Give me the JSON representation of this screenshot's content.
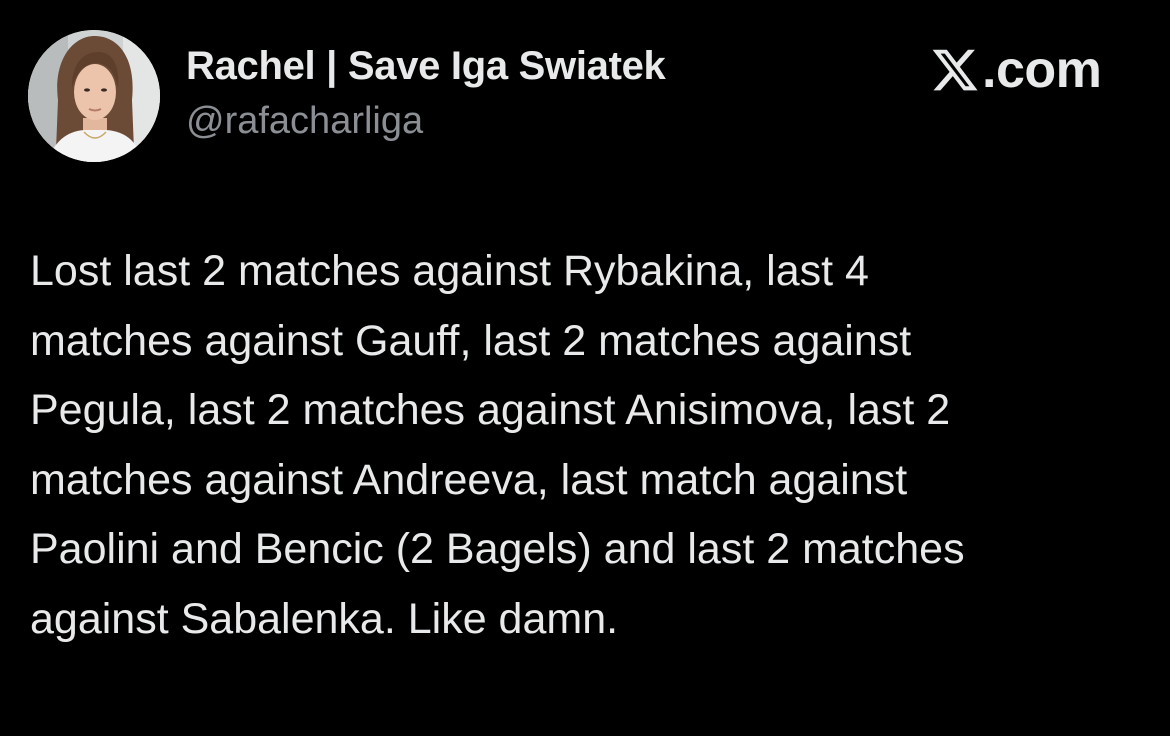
{
  "author": {
    "display_name": "Rachel | Save Iga Swiatek",
    "handle": "@rafacharliga",
    "avatar_icon": "profile-photo"
  },
  "brand": {
    "icon": "x-logo-icon",
    "text": ".com"
  },
  "tweet": {
    "lines": [
      "Lost last 2 matches against Rybakina, last 4",
      "matches against Gauff, last 2 matches against",
      "Pegula, last 2 matches against Anisimova, last 2",
      "matches against Andreeva, last match against",
      "Paolini and Bencic (2 Bagels) and last 2 matches",
      "against Sabalenka. Like damn."
    ]
  },
  "colors": {
    "background": "#000000",
    "primary_text": "#e7e9ea",
    "secondary_text": "#8b8f94"
  }
}
